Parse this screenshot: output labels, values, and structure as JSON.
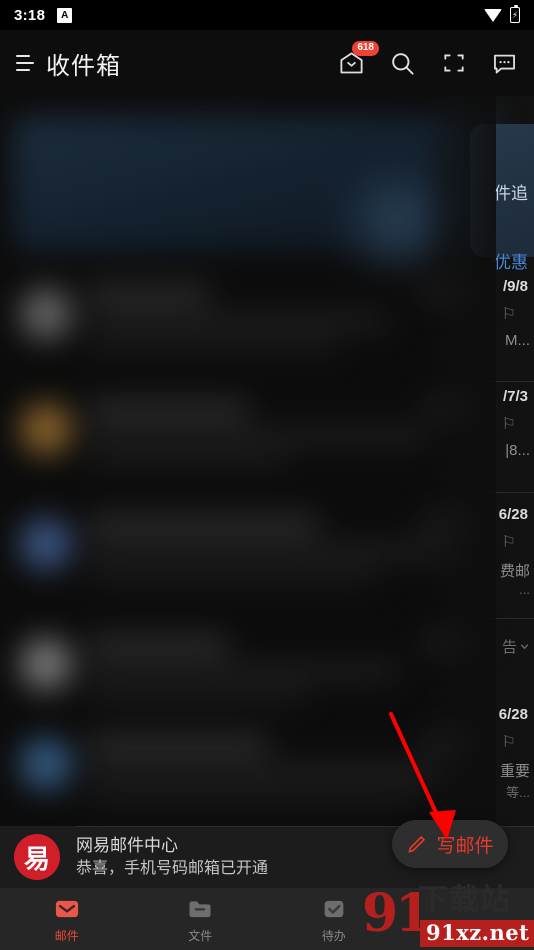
{
  "status_bar": {
    "time": "3:18",
    "app_badge": "A",
    "wifi_icon": "wifi-icon",
    "battery_icon": "battery-charging-icon"
  },
  "app_bar": {
    "menu_icon": "hamburger-menu-icon",
    "title": "收件箱",
    "actions": [
      {
        "name": "gift-box-icon",
        "badge": "618"
      },
      {
        "name": "search-icon",
        "badge": ""
      },
      {
        "name": "scan-icon",
        "badge": ""
      },
      {
        "name": "chat-icon",
        "badge": ""
      }
    ]
  },
  "mail_list": {
    "promo_card": {
      "line_1": "件追",
      "line_2": "优惠"
    },
    "items": [
      {
        "date": "/9/8",
        "flag": "⚐",
        "subject": "M...",
        "snippet": ""
      },
      {
        "date": "/7/3",
        "flag": "⚐",
        "subject": "|8...",
        "snippet": ""
      },
      {
        "date": "6/28",
        "flag": "⚐",
        "subject": "费邮",
        "snippet": "..."
      },
      {
        "date": "6/28",
        "flag": "⚐",
        "subject": "重要",
        "snippet": "等..."
      }
    ],
    "ad_label": "告",
    "ad_chevron": "chevron-down-icon"
  },
  "notification": {
    "avatar_glyph": "易",
    "title": "网易邮件中心",
    "subtitle": "恭喜，手机号码邮箱已开通"
  },
  "compose_button": {
    "icon": "pencil-icon",
    "label": "写邮件",
    "color": "#e8392c"
  },
  "annotation": {
    "arrow_color": "#fe0000",
    "type": "arrow-pointing-to-compose-button"
  },
  "bottom_nav": {
    "items": [
      {
        "icon": "mail-icon",
        "label": "邮件",
        "active": true
      },
      {
        "icon": "folder-icon",
        "label": "文件",
        "active": false
      },
      {
        "icon": "checkbox-icon",
        "label": "待办",
        "active": false
      }
    ],
    "active_color": "#e8493a",
    "inactive_color": "#8a8a8a"
  },
  "watermark": {
    "number": "91",
    "chinese": "下载站",
    "url": "91xz.net"
  }
}
